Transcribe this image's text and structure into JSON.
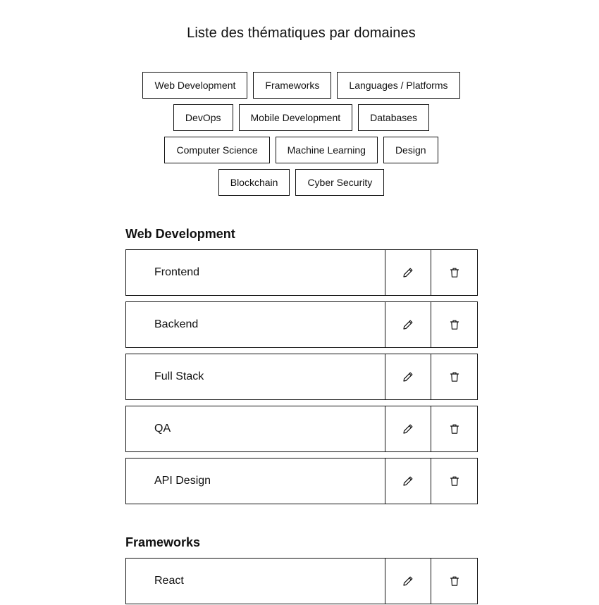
{
  "page_title": "Liste des thématiques par domaines",
  "domain_filters": {
    "rows": [
      [
        "Web Development",
        "Frameworks",
        "Languages / Platforms"
      ],
      [
        "DevOps",
        "Mobile Development",
        "Databases"
      ],
      [
        "Computer Science",
        "Machine Learning",
        "Design"
      ],
      [
        "Blockchain",
        "Cyber Security"
      ]
    ]
  },
  "sections": [
    {
      "title": "Web Development",
      "items": [
        "Frontend",
        "Backend",
        "Full Stack",
        "QA",
        "API Design"
      ]
    },
    {
      "title": "Frameworks",
      "items": [
        "React"
      ]
    }
  ],
  "icons": {
    "edit": "pencil-icon",
    "delete": "trash-icon"
  },
  "colors": {
    "border": "#111111",
    "background": "#ffffff",
    "text": "#111111"
  }
}
